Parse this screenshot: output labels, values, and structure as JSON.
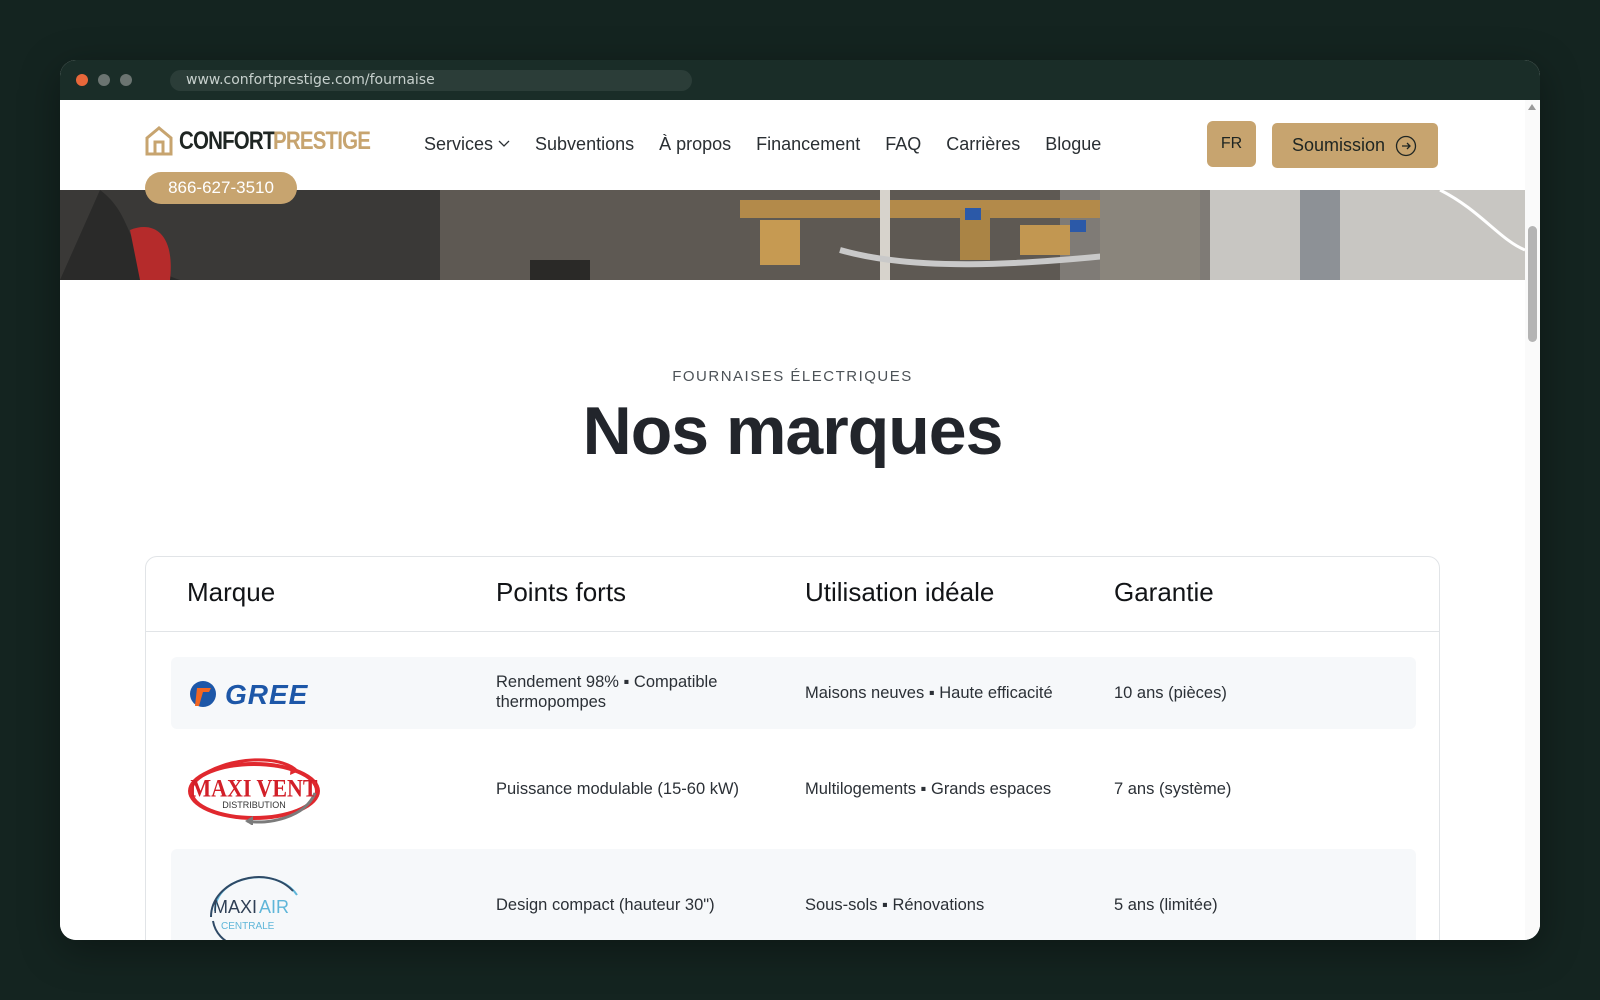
{
  "browser": {
    "url": "www.confortprestige.com/fournaise",
    "colors": {
      "close": "#e8673a",
      "dot": "#6b7471"
    }
  },
  "header": {
    "logo": {
      "part1": "CONFORT",
      "part2": "PRESTIGE",
      "icon": "house-icon"
    },
    "nav": [
      {
        "label": "Services",
        "has_dropdown": true
      },
      {
        "label": "Subventions"
      },
      {
        "label": "À propos"
      },
      {
        "label": "Financement"
      },
      {
        "label": "FAQ"
      },
      {
        "label": "Carrières"
      },
      {
        "label": "Blogue"
      }
    ],
    "language": "FR",
    "cta": {
      "label": "Soumission",
      "icon": "arrow-circle-icon"
    },
    "phone": "866-627-3510",
    "accent_color": "#c7a46f"
  },
  "section": {
    "eyebrow": "FOURNAISES ÉLECTRIQUES",
    "title": "Nos marques"
  },
  "table": {
    "headers": [
      "Marque",
      "Points forts",
      "Utilisation idéale",
      "Garantie"
    ],
    "rows": [
      {
        "brand": "GREE",
        "strengths": "Rendement 98% ▪ Compatible thermopompes",
        "ideal_use": "Maisons neuves ▪ Haute efficacité",
        "warranty": "10 ans (pièces)"
      },
      {
        "brand": "MAXI VENT",
        "brand_sub": "DISTRIBUTION",
        "strengths": "Puissance modulable (15-60 kW)",
        "ideal_use": "Multilogements ▪ Grands espaces",
        "warranty": "7 ans (système)"
      },
      {
        "brand_a": "MAXI",
        "brand_b": "AIR",
        "brand_sub": "CENTRALE",
        "strengths": "Design compact (hauteur 30\")",
        "ideal_use": "Sous-sols ▪ Rénovations",
        "warranty": "5 ans (limitée)"
      }
    ]
  }
}
